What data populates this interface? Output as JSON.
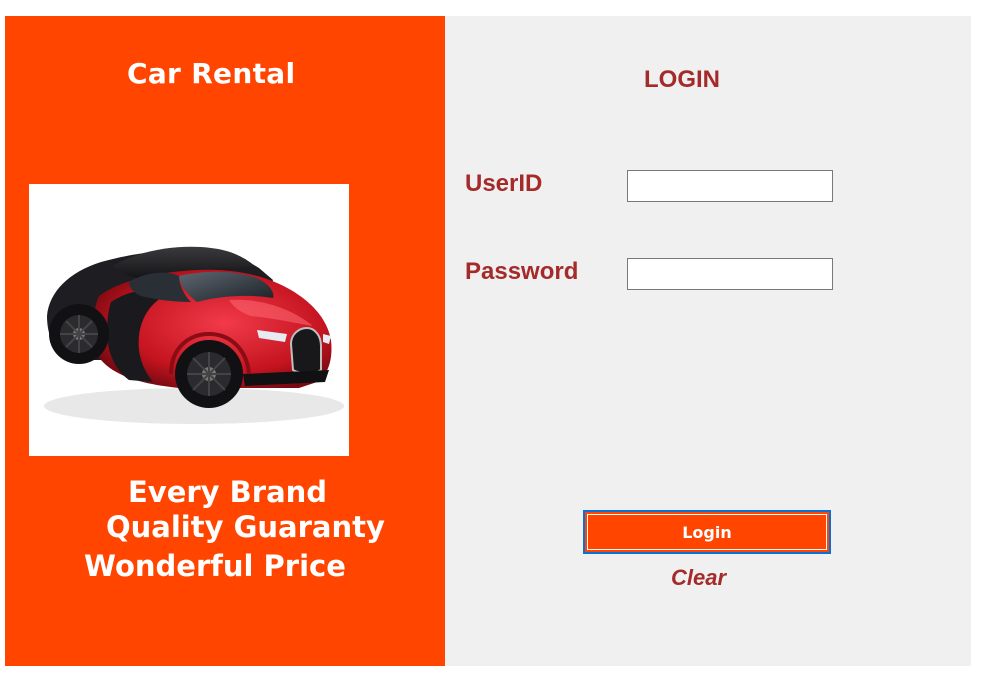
{
  "brand": {
    "title": "Car Rental",
    "taglines": [
      "Every Brand",
      "Quality Guaranty",
      "Wonderful Price"
    ],
    "image_icon": "sports-car-image"
  },
  "login": {
    "title": "LOGIN",
    "userid_label": "UserID",
    "userid_value": "",
    "password_label": "Password",
    "password_value": "",
    "login_button": "Login",
    "clear_link": "Clear"
  },
  "colors": {
    "left_panel": "#FF4500",
    "right_panel": "#F0F0F0",
    "label_text": "#A52A2A",
    "button_focus_border": "#0A70D6"
  }
}
